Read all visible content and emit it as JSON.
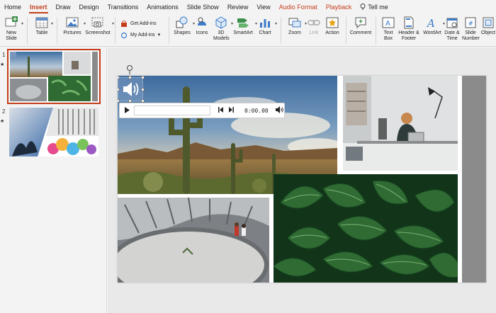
{
  "tabs": [
    {
      "label": "Home"
    },
    {
      "label": "Insert"
    },
    {
      "label": "Draw"
    },
    {
      "label": "Design"
    },
    {
      "label": "Transitions"
    },
    {
      "label": "Animations"
    },
    {
      "label": "Slide Show"
    },
    {
      "label": "Review"
    },
    {
      "label": "View"
    },
    {
      "label": "Audio Format"
    },
    {
      "label": "Playback"
    }
  ],
  "tellme": "Tell me",
  "ribbon": {
    "new_slide": "New Slide",
    "table": "Table",
    "pictures": "Pictures",
    "screenshot": "Screenshot",
    "get_addins": "Get Add-ins",
    "my_addins": "My Add-ins",
    "shapes": "Shapes",
    "icons": "Icons",
    "models_3d": "3D Models",
    "smartart": "SmartArt",
    "chart": "Chart",
    "zoom": "Zoom",
    "link": "Link",
    "action": "Action",
    "comment": "Comment",
    "text_box": "Text Box",
    "header_footer": "Header & Footer",
    "wordart": "WordArt",
    "date_time": "Date & Time",
    "slide_number": "Slide Number",
    "object": "Object"
  },
  "slides": [
    {
      "num": "1",
      "star": "★"
    },
    {
      "num": "2",
      "star": "★"
    }
  ],
  "audio": {
    "time": "0:00.00",
    "play_icon": "play-icon",
    "back_icon": "skip-back-icon",
    "fwd_icon": "skip-forward-icon",
    "volume_icon": "volume-icon"
  },
  "colors": {
    "accent": "#c43e1c",
    "sky": "#4f7fb0",
    "desert": "#8a6a3c",
    "leaves": "#2f6b33"
  }
}
